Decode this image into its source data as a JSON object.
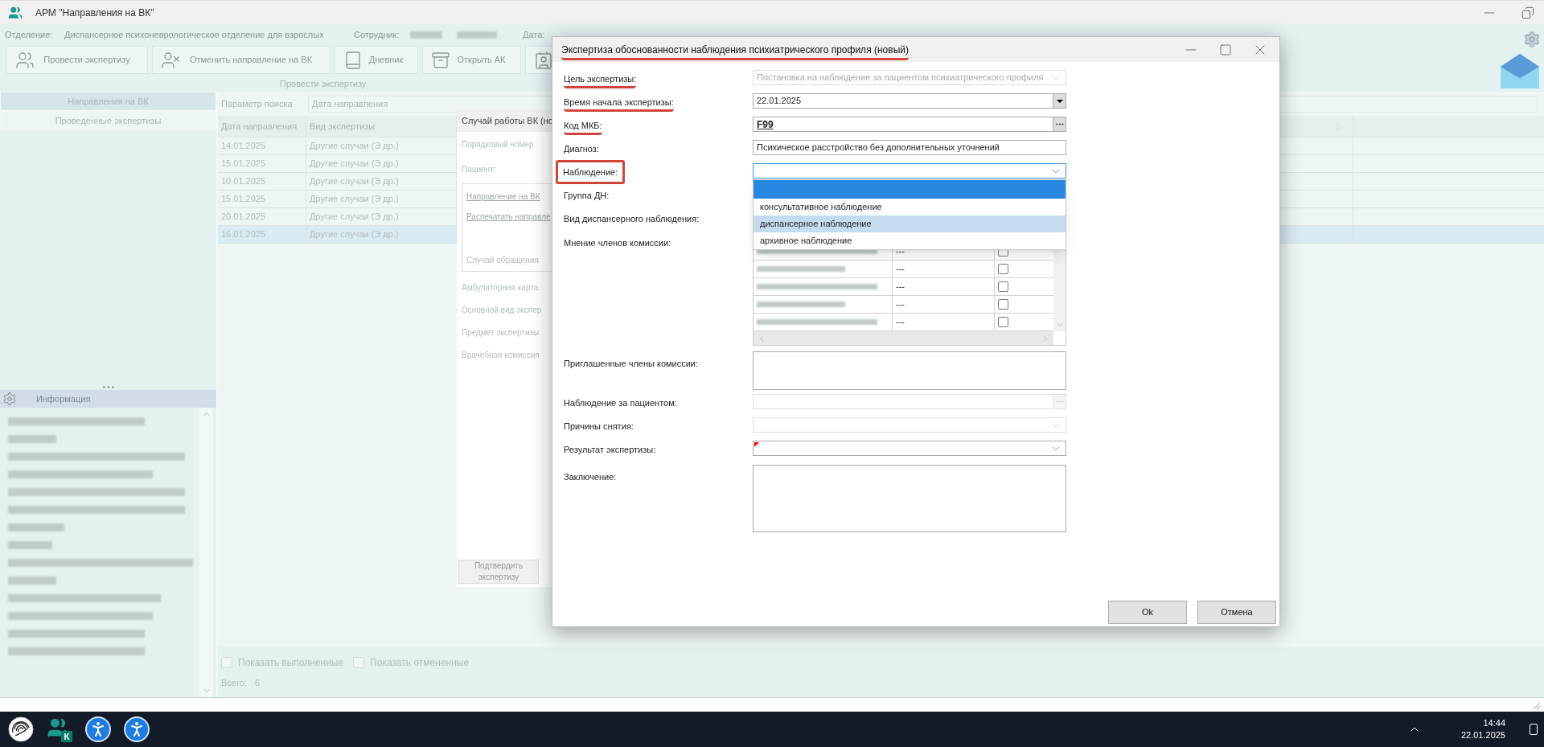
{
  "window": {
    "title": "АРМ \"Направления на ВК\""
  },
  "header": {
    "department_label": "Отделение:",
    "department": "Диспансерное психоневрологическое отделение для взрослых",
    "employee_label": "Сотрудник:",
    "date_label": "Дата:"
  },
  "toolbar": {
    "buttons": [
      {
        "kind": "labeled",
        "label": "Провести экспертизу"
      },
      {
        "kind": "labeled",
        "label": "Отменить направление на ВК"
      },
      {
        "kind": "labeled",
        "label": "Дневник"
      },
      {
        "kind": "labeled",
        "label": "Открыть АК"
      },
      {
        "kind": "icon_only"
      }
    ],
    "caption": "Провести экспертизу"
  },
  "left_tabs": [
    {
      "label": "Направления на ВК",
      "selected": true
    },
    {
      "label": "Проведенные экспертизы",
      "selected": false
    }
  ],
  "info_panel": {
    "title": "Информация"
  },
  "search": {
    "label": "Параметр поиска",
    "value": "Дата направления"
  },
  "table": {
    "columns": [
      "Дата направления",
      "Вид экспертизы"
    ],
    "rows": [
      {
        "date": "14.01.2025",
        "type": "Другие случаи (Э др.)",
        "selected": false
      },
      {
        "date": "15.01.2025",
        "type": "Другие случаи (Э др.)",
        "selected": false
      },
      {
        "date": "10.01.2025",
        "type": "Другие случаи (Э др.)",
        "selected": false
      },
      {
        "date": "15.01.2025",
        "type": "Другие случаи (Э др.)",
        "selected": false
      },
      {
        "date": "20.01.2025",
        "type": "Другие случаи (Э др.)",
        "selected": false
      },
      {
        "date": "16.01.2025",
        "type": "Другие случаи (Э др.)",
        "selected": true
      }
    ]
  },
  "case_panel": {
    "title": "Случай работы ВК (но",
    "labels_top": [
      "Порядковый номер",
      "Пациент:"
    ],
    "links": [
      "Направление на ВК",
      "Распечатать направле"
    ],
    "box_label": "Случай обращения",
    "labels_bottom": [
      "Амбулаторная карта",
      "Основной вид экспер",
      "Предмет экспертизы",
      "Врачебная комиссия"
    ],
    "button": "Подтвердить экспертизу"
  },
  "footer": {
    "checkboxes": [
      {
        "label": "Показать выполненные",
        "checked": false
      },
      {
        "label": "Показать отмененные",
        "checked": false
      }
    ],
    "total_label": "Всего:",
    "total": "6"
  },
  "dialog": {
    "title": "Экспертиза обоснованности наблюдения психиатрического профиля (новый)",
    "title_underlined": true,
    "fields": [
      {
        "kind": "select",
        "label": "Цель экспертизы:",
        "value": "Постановка на наблюдение за пациентом психиатрического профиля",
        "disabled": true,
        "underlined": true
      },
      {
        "kind": "date",
        "label": "Время начала экспертизы:",
        "value": "22.01.2025",
        "disabled": false,
        "underlined": true
      },
      {
        "kind": "lookup",
        "label": "Код МКБ:",
        "value": "F99",
        "disabled": false,
        "underlined": true
      },
      {
        "kind": "text",
        "label": "Диагноз:",
        "value": "Психическое расстройство без дополнительных уточнений"
      },
      {
        "kind": "select",
        "label": "Наблюдение:",
        "disabled": false,
        "boxed": true,
        "expanded": true,
        "options": [
          {
            "selected": true
          },
          {
            "label": "консультативное наблюдение",
            "selected": false
          },
          {
            "label": "диспансерное наблюдение",
            "selected": false,
            "hovered": true
          },
          {
            "label": "архивное наблюдение",
            "selected": false
          }
        ]
      },
      {
        "kind": "label",
        "label": "Группа ДН:"
      },
      {
        "kind": "label",
        "label": "Вид диспансерного наблюдения:"
      },
      {
        "kind": "grid",
        "label": "Мнение членов комиссии:",
        "rows": [
          {
            "opinion": "---",
            "checked": false
          },
          {
            "opinion": "---",
            "checked": false
          },
          {
            "opinion": "---",
            "checked": false
          },
          {
            "opinion": "---",
            "checked": false
          },
          {
            "opinion": "---",
            "checked": false
          }
        ]
      },
      {
        "kind": "textarea",
        "label": "Приглашенные члены комиссии:",
        "tall": false
      },
      {
        "kind": "lookup",
        "label": "Наблюдение за пациентом:",
        "disabled": true
      },
      {
        "kind": "select",
        "label": "Причины снятия:",
        "disabled": true
      },
      {
        "kind": "select",
        "label": "Результат экспертизы:",
        "disabled": false,
        "required": true
      },
      {
        "kind": "textarea",
        "label": "Заключение:",
        "tall": true
      }
    ],
    "buttons": [
      "Ok",
      "Отмена"
    ]
  },
  "taskbar": {
    "apps": [
      {
        "kind": "fingerprint"
      },
      {
        "kind": "people",
        "badge": "K"
      },
      {
        "kind": "accessibility"
      },
      {
        "kind": "accessibility"
      }
    ],
    "time": "14:44",
    "date": "22.01.2025"
  }
}
